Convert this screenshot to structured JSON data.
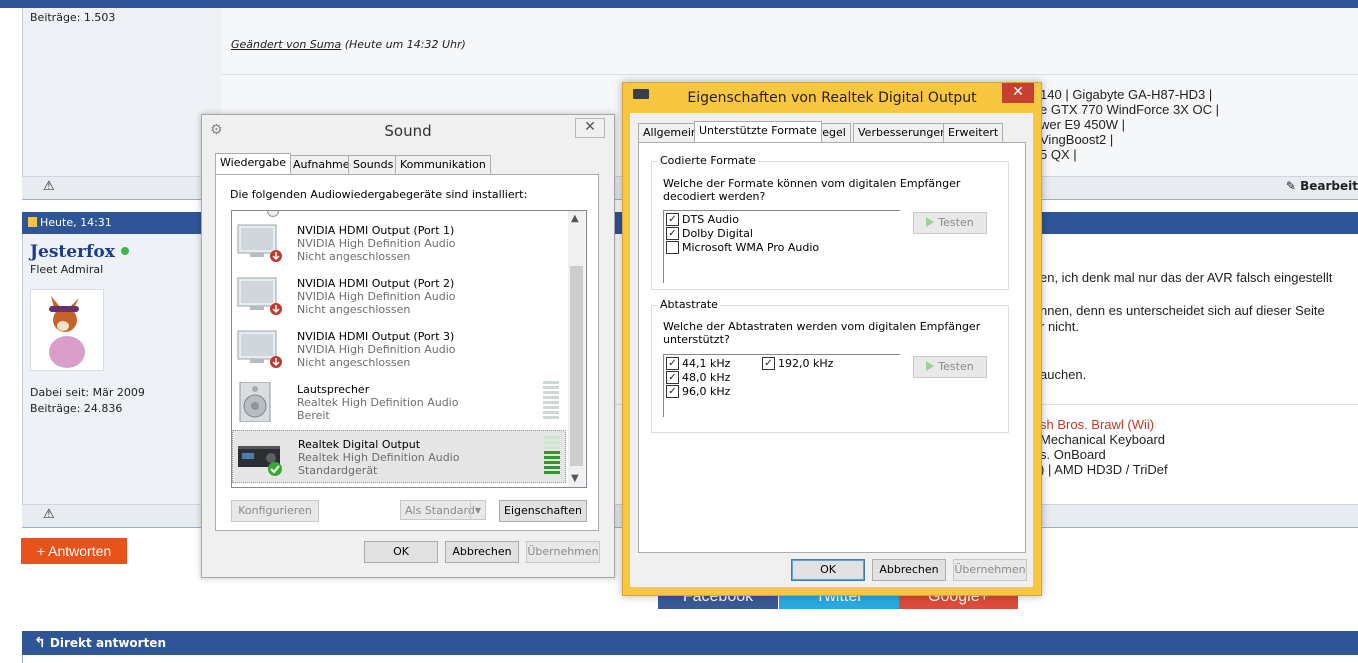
{
  "forum": {
    "post1": {
      "beitraege": "Beiträge: 1.503",
      "edited_by": "Geändert von Suma",
      "edited_time": "(Heute um 14:32 Uhr)",
      "sig_lines": [
        [
          {
            "t": "140",
            "l": true
          },
          {
            "t": " | ",
            "l": false
          },
          {
            "t": "Gigabyte GA-H87-HD3",
            "l": true
          },
          {
            "t": " |",
            "l": false
          }
        ],
        [
          {
            "t": "e GTX 770 WindForce 3X OC",
            "l": true
          },
          {
            "t": " |",
            "l": false
          }
        ],
        [
          {
            "t": "wer E9 450W",
            "l": true
          },
          {
            "t": " |",
            "l": false
          }
        ],
        [
          {
            "t": "VingBoost2",
            "l": true
          },
          {
            "t": " |",
            "l": false
          }
        ],
        [
          {
            "t": "5 QX",
            "l": true
          },
          {
            "t": " |",
            "l": false
          }
        ]
      ],
      "edit_label": "Bearbeit"
    },
    "post2": {
      "date": "Heute, 14:31",
      "username": "Jesterfox",
      "rank": "Fleet Admiral",
      "joined": "Dabei seit: Mär 2009",
      "beitraege": "Beiträge: 24.836",
      "text_lines": [
        "en, ich denk mal nur das der AVR falsch eingestellt",
        "nnen, denn es unterscheidet sich auf dieser Seite",
        "r nicht.",
        "auchen."
      ],
      "sig_lines": [
        [
          {
            "t": "sh Bros. Brawl (Wii)",
            "l": true,
            "red": true
          }
        ],
        [
          {
            "t": " Mechanical Keyboard",
            "l": true
          }
        ],
        [
          {
            "t": "s. OnBoard",
            "l": true
          }
        ],
        [
          {
            "t": ")",
            "l": true
          },
          {
            "t": " | ",
            "l": false
          },
          {
            "t": "AMD HD3D / TriDef",
            "l": true
          }
        ]
      ]
    },
    "reply_button": "+ Antworten",
    "social": [
      "Facebook",
      "Twitter",
      "Google+"
    ],
    "direct_reply": "Direkt antworten"
  },
  "sound_dialog": {
    "title": "Sound",
    "tabs": [
      "Wiedergabe",
      "Aufnahme",
      "Sounds",
      "Kommunikation"
    ],
    "intro": "Die folgenden Audiowiedergabegeräte sind installiert:",
    "devices": [
      {
        "name": "NVIDIA HDMI Output (Port 1)",
        "driver": "NVIDIA High Definition Audio",
        "status": "Nicht angeschlossen",
        "icon": "monitor-icon"
      },
      {
        "name": "NVIDIA HDMI Output (Port 2)",
        "driver": "NVIDIA High Definition Audio",
        "status": "Nicht angeschlossen",
        "icon": "monitor-icon"
      },
      {
        "name": "NVIDIA HDMI Output (Port 3)",
        "driver": "NVIDIA High Definition Audio",
        "status": "Nicht angeschlossen",
        "icon": "monitor-icon"
      },
      {
        "name": "Lautsprecher",
        "driver": "Realtek High Definition Audio",
        "status": "Bereit",
        "icon": "speaker-icon"
      },
      {
        "name": "Realtek Digital Output",
        "driver": "Realtek High Definition Audio",
        "status": "Standardgerät",
        "icon": "receiver-icon"
      }
    ],
    "btn_configure": "Konfigurieren",
    "btn_default": "Als Standard",
    "btn_properties": "Eigenschaften",
    "btn_ok": "OK",
    "btn_cancel": "Abbrechen",
    "btn_apply": "Übernehmen"
  },
  "realtek_dialog": {
    "title": "Eigenschaften von Realtek Digital Output",
    "tabs": [
      "Allgemein",
      "Unterstützte Formate",
      "Pegel",
      "Verbesserungen",
      "Erweitert"
    ],
    "encoded_group": "Codierte Formate",
    "encoded_question": "Welche der Formate können vom digitalen Empfänger decodiert werden?",
    "formats": [
      {
        "label": "DTS Audio",
        "checked": true
      },
      {
        "label": "Dolby Digital",
        "checked": true
      },
      {
        "label": "Microsoft WMA Pro Audio",
        "checked": false
      }
    ],
    "test_label": "Testen",
    "rate_group": "Abtastrate",
    "rate_question": "Welche der Abtastraten werden vom digitalen Empfänger unterstützt?",
    "rates_col1": [
      {
        "label": "44,1 kHz",
        "checked": true
      },
      {
        "label": "48,0 kHz",
        "checked": true
      },
      {
        "label": "96,0 kHz",
        "checked": true
      }
    ],
    "rates_col2": [
      {
        "label": "192,0 kHz",
        "checked": true
      }
    ],
    "btn_ok": "OK",
    "btn_cancel": "Abbrechen",
    "btn_apply": "Übernehmen"
  },
  "colors": {
    "forum_blue": "#2f5597",
    "reply_orange": "#e8531c",
    "window_frame": "#f9c63f",
    "close_red": "#c7402e",
    "facebook": "#3b5998",
    "twitter": "#2aa9e0",
    "google": "#dd4b39"
  }
}
